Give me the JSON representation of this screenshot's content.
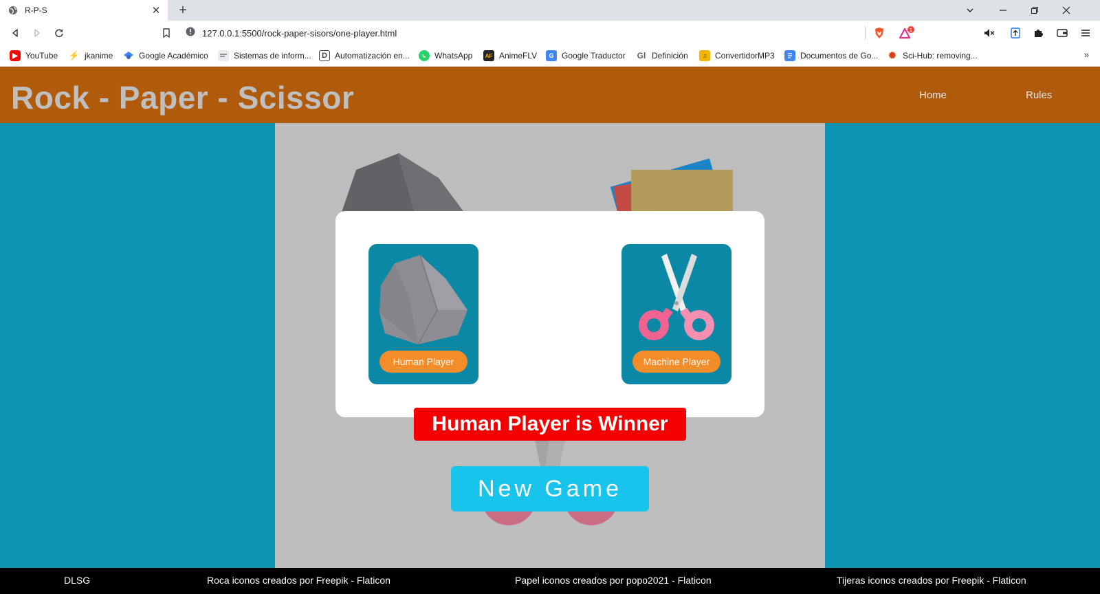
{
  "browser": {
    "tab_title": "R-P-S",
    "url": "127.0.0.1:5500/rock-paper-sisors/one-player.html",
    "bookmarks": [
      {
        "label": "YouTube",
        "icon": "youtube-icon",
        "color": "#ff0000"
      },
      {
        "label": "jkanime",
        "icon": "jkanime-icon",
        "color": "#f4b400"
      },
      {
        "label": "Google Académico",
        "icon": "google-scholar-icon",
        "color": "#4285f4"
      },
      {
        "label": "Sistemas de inform...",
        "icon": "page-icon",
        "color": "#9aa0a6"
      },
      {
        "label": "Automatización en...",
        "icon": "d-icon",
        "color": "#3c4043"
      },
      {
        "label": "WhatsApp",
        "icon": "whatsapp-icon",
        "color": "#25d366"
      },
      {
        "label": "AnimeFLV",
        "icon": "animeflv-icon",
        "color": "#222222"
      },
      {
        "label": "Google Traductor",
        "icon": "translate-icon",
        "color": "#4285f4"
      },
      {
        "label": "Definición",
        "icon": "definition-icon",
        "color": "#5f6368"
      },
      {
        "label": "ConvertidorMP3",
        "icon": "converter-icon",
        "color": "#f4b400"
      },
      {
        "label": "Documentos de Go...",
        "icon": "docs-icon",
        "color": "#4285f4"
      },
      {
        "label": "Sci-Hub: removing...",
        "icon": "scihub-icon",
        "color": "#d84315"
      }
    ],
    "bookmarks_more": "»",
    "brave_badge": "1"
  },
  "site": {
    "title": "Rock - Paper - Scissor",
    "nav": {
      "home": "Home",
      "rules": "Rules"
    }
  },
  "game": {
    "human": {
      "label": "Human Player",
      "choice": "rock"
    },
    "machine": {
      "label": "Machine Player",
      "choice": "scissors"
    },
    "result": "Human Player is Winner",
    "new_game": "New Game"
  },
  "footer": {
    "author": "DLSG",
    "credit_rock": "Roca iconos creados por Freepik - Flaticon",
    "credit_paper": "Papel iconos creados por popo2021 - Flaticon",
    "credit_scissors": "Tijeras iconos creados por Freepik - Flaticon"
  },
  "colors": {
    "header": "#b05a0c",
    "page_bg": "#0b95b3",
    "stage_bg": "#bdbdbd",
    "card_bg": "#0a88a6",
    "card_label": "#f38d2a",
    "winner_bg": "#f50000",
    "new_game_bg": "#18c4ec"
  }
}
